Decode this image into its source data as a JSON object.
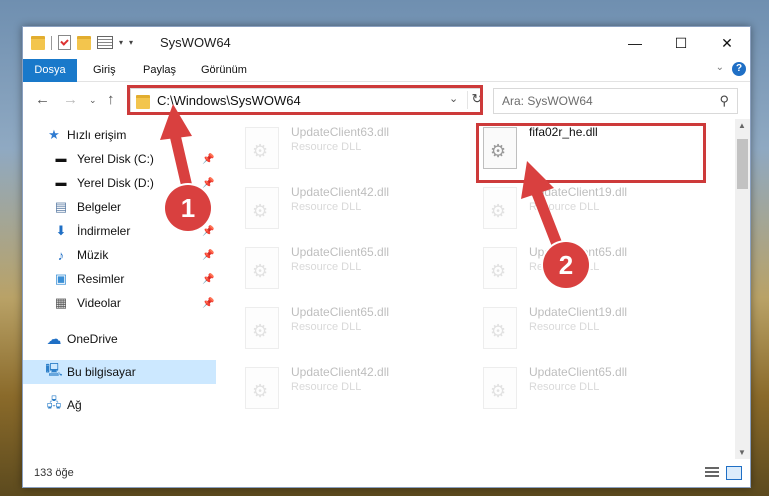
{
  "window": {
    "title": "SysWOW64"
  },
  "ribbon": {
    "tabs": [
      "Dosya",
      "Giriş",
      "Paylaş",
      "Görünüm"
    ]
  },
  "address": {
    "path": "C:\\Windows\\SysWOW64"
  },
  "search": {
    "placeholder": "Ara: SysWOW64"
  },
  "sidebar": {
    "items": [
      {
        "label": "Hızlı erişim"
      },
      {
        "label": "Yerel Disk (C:)"
      },
      {
        "label": "Yerel Disk (D:)"
      },
      {
        "label": "Belgeler"
      },
      {
        "label": "İndirmeler"
      },
      {
        "label": "Müzik"
      },
      {
        "label": "Resimler"
      },
      {
        "label": "Videolar"
      },
      {
        "label": "OneDrive"
      },
      {
        "label": "Bu bilgisayar"
      },
      {
        "label": "Ağ"
      }
    ]
  },
  "files": [
    {
      "name": "UpdateClient63.dll",
      "type": "Resource DLL"
    },
    {
      "name": "fifa02r_he.dll",
      "type": ""
    },
    {
      "name": "UpdateClient42.dll",
      "type": "Resource DLL"
    },
    {
      "name": "UpdateClient19.dll",
      "type": "Resource DLL"
    },
    {
      "name": "UpdateClient65.dll",
      "type": "Resource DLL"
    },
    {
      "name": "UpdateClient65.dll",
      "type": "Resource DLL"
    },
    {
      "name": "UpdateClient65.dll",
      "type": "Resource DLL"
    },
    {
      "name": "UpdateClient19.dll",
      "type": "Resource DLL"
    },
    {
      "name": "UpdateClient42.dll",
      "type": "Resource DLL"
    },
    {
      "name": "UpdateClient65.dll",
      "type": "Resource DLL"
    }
  ],
  "status": {
    "count": "133 öğe"
  },
  "annotations": {
    "step1": "1",
    "step2": "2"
  },
  "colors": {
    "accent": "#1979ca",
    "highlight_red": "#cd3a3a",
    "selection": "#cce8ff"
  }
}
